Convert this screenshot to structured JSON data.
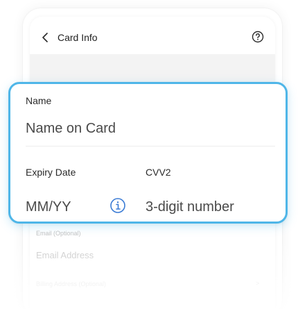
{
  "header": {
    "title": "Card Info",
    "back_icon": "chevron-left-icon",
    "help_icon": "question-circle-icon"
  },
  "form": {
    "name_label": "Name",
    "name_placeholder": "Name on Card",
    "expiry_label": "Expiry Date",
    "expiry_placeholder": "MM/YY",
    "cvv_label": "CVV2",
    "cvv_placeholder": "3-digit number",
    "info_icon": "info-circle-icon"
  },
  "lower": {
    "email_label": "Email (Optional)",
    "email_placeholder": "Email Address",
    "billing_label": "Billing Address (Optional)",
    "billing_chevron": ">"
  },
  "colors": {
    "accent": "#4fb6e8",
    "text": "#1f1f1f",
    "placeholder": "#4a4a4a"
  }
}
